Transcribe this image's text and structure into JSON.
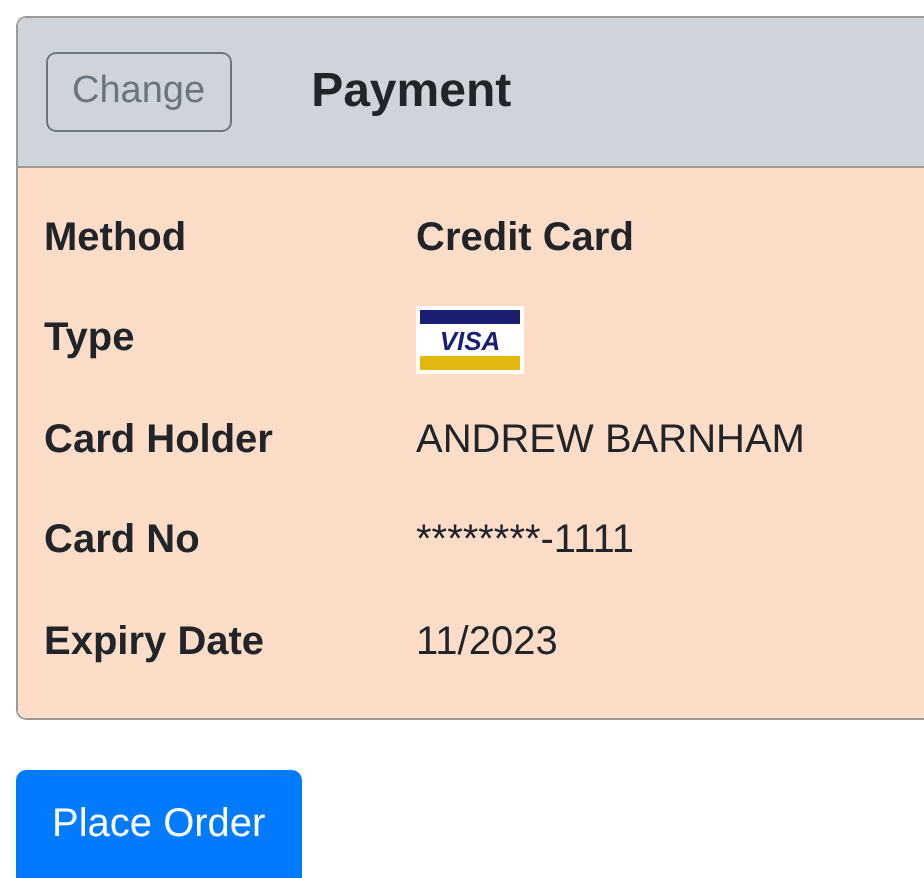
{
  "header": {
    "change_button": {
      "label": "Change",
      "disabled": true
    },
    "title": "Payment"
  },
  "rows": [
    {
      "label": "Method",
      "kind": "bold",
      "value": "Credit Card"
    },
    {
      "label": "Type",
      "kind": "card-logo",
      "value": "VISA"
    },
    {
      "label": "Card Holder",
      "kind": "text",
      "value": "ANDREW BARNHAM"
    },
    {
      "label": "Card No",
      "kind": "text",
      "value": "********-1111"
    },
    {
      "label": "Expiry Date",
      "kind": "text",
      "value": "11/2023"
    }
  ],
  "place_order_button": {
    "label": "Place Order"
  }
}
